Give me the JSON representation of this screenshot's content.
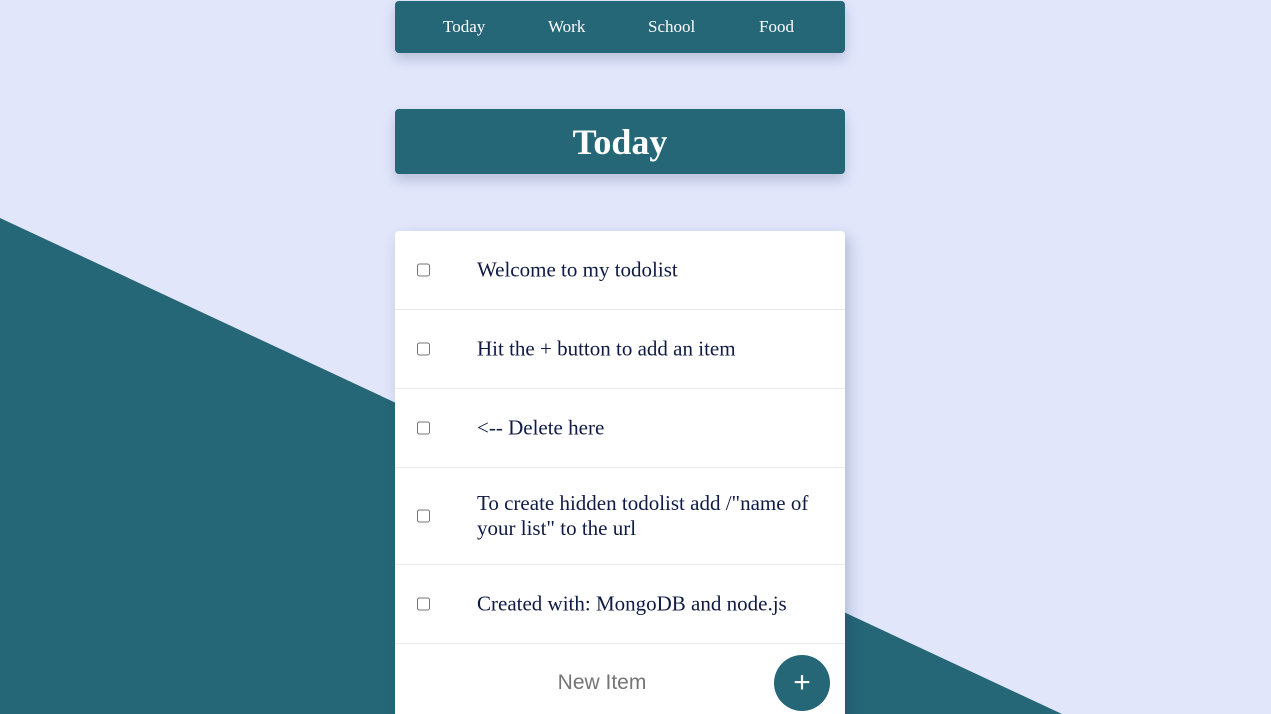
{
  "colors": {
    "background": "#e1e6fb",
    "accent": "#256677",
    "card": "#ffffff",
    "item_text": "#0f1b45"
  },
  "nav": {
    "items": [
      {
        "label": "Today"
      },
      {
        "label": "Work"
      },
      {
        "label": "School"
      },
      {
        "label": "Food"
      }
    ]
  },
  "heading": {
    "title": "Today"
  },
  "list": {
    "items": [
      {
        "text": "Welcome to my todolist",
        "checked": false
      },
      {
        "text": "Hit the + button to add an item",
        "checked": false
      },
      {
        "text": "<-- Delete here",
        "checked": false
      },
      {
        "text": "To create hidden todolist add /\"name of your list\" to the url",
        "checked": false
      },
      {
        "text": "Created with: MongoDB and node.js",
        "checked": false
      }
    ],
    "new_item": {
      "placeholder": "New Item",
      "value": ""
    },
    "add_button": {
      "label": "+",
      "icon": "plus-icon"
    }
  }
}
